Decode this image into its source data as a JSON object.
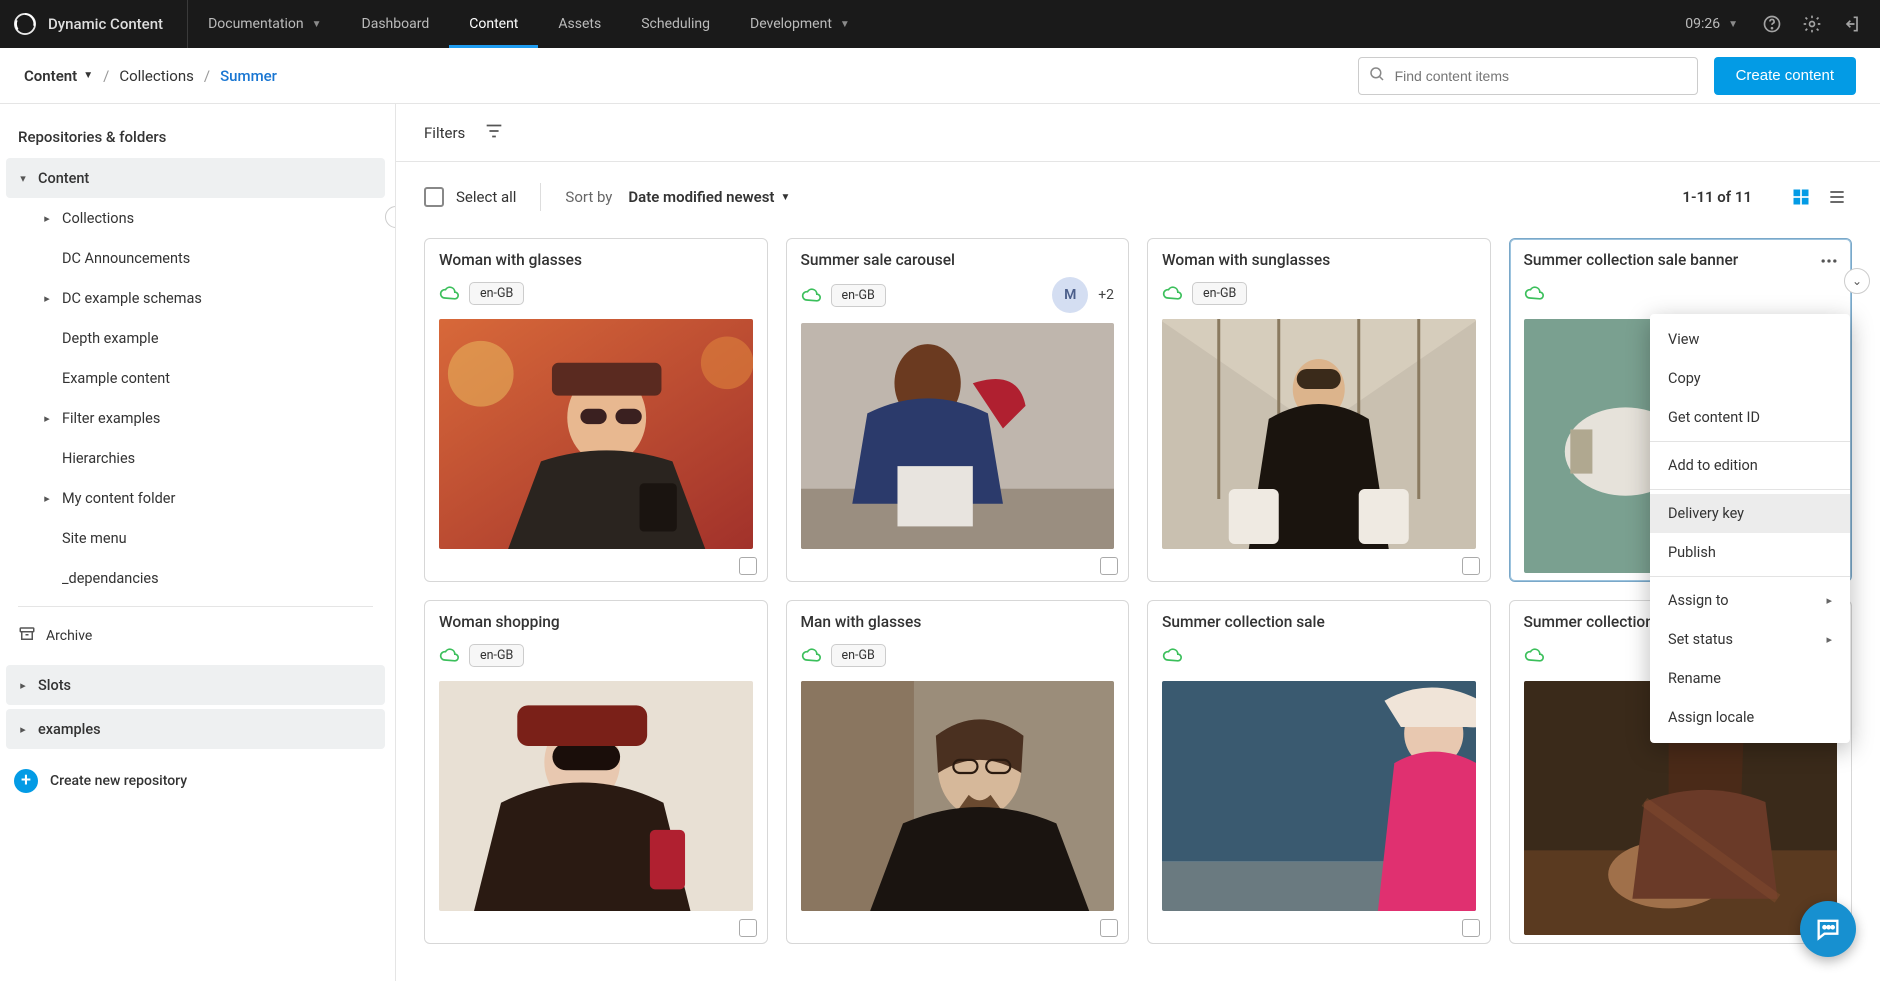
{
  "brand": {
    "name": "Dynamic Content"
  },
  "topnav": {
    "documentation": "Documentation",
    "dashboard": "Dashboard",
    "content": "Content",
    "assets": "Assets",
    "scheduling": "Scheduling",
    "development": "Development",
    "clock": "09:26"
  },
  "breadcrumb": {
    "root": "Content",
    "mid": "Collections",
    "leaf": "Summer"
  },
  "search": {
    "placeholder": "Find content items"
  },
  "buttons": {
    "create_content": "Create content"
  },
  "sidebar": {
    "heading": "Repositories & folders",
    "content_root": "Content",
    "items": {
      "collections": "Collections",
      "dc_announcements": "DC Announcements",
      "dc_example_schemas": "DC example schemas",
      "depth_example": "Depth example",
      "example_content": "Example content",
      "filter_examples": "Filter examples",
      "hierarchies": "Hierarchies",
      "my_content_folder": "My content folder",
      "site_menu": "Site menu",
      "dependancies": "_dependancies"
    },
    "archive": "Archive",
    "slots": "Slots",
    "examples": "examples",
    "create_repo": "Create new repository"
  },
  "filters": {
    "label": "Filters"
  },
  "toolbar": {
    "select_all": "Select all",
    "sort_by": "Sort by",
    "sort_value": "Date modified newest",
    "count": "1-11 of 11"
  },
  "cards": [
    {
      "title": "Woman with glasses",
      "locale": "en-GB"
    },
    {
      "title": "Summer sale carousel",
      "locale": "en-GB",
      "avatar": "M",
      "extra": "+2"
    },
    {
      "title": "Woman with sunglasses",
      "locale": "en-GB"
    },
    {
      "title": "Summer collection sale banner",
      "locale": ""
    },
    {
      "title": "Woman shopping",
      "locale": "en-GB"
    },
    {
      "title": "Man with glasses",
      "locale": "en-GB"
    },
    {
      "title": "Summer collection sale",
      "locale": ""
    },
    {
      "title": "Summer collection",
      "locale": ""
    }
  ],
  "context_menu": {
    "view": "View",
    "copy": "Copy",
    "get_id": "Get content ID",
    "add_edition": "Add to edition",
    "delivery_key": "Delivery key",
    "publish": "Publish",
    "assign_to": "Assign to",
    "set_status": "Set status",
    "rename": "Rename",
    "assign_locale": "Assign locale"
  }
}
